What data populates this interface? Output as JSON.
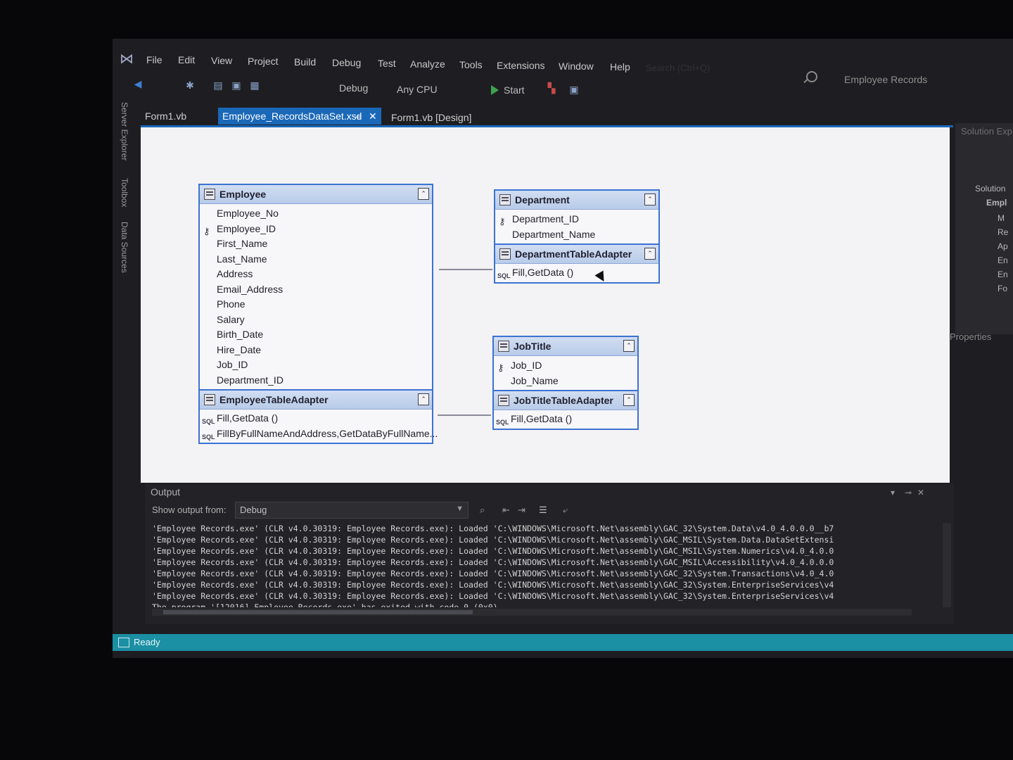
{
  "menu": {
    "items": [
      "File",
      "Edit",
      "View",
      "Project",
      "Build",
      "Debug",
      "Test",
      "Analyze",
      "Tools",
      "Extensions",
      "Window",
      "Help"
    ],
    "search_placeholder": "Search (Ctrl+Q)",
    "project_title": "Employee Records"
  },
  "toolbar": {
    "config": "Debug",
    "platform": "Any CPU",
    "start_label": "Start"
  },
  "side_tabs": [
    "Server Explorer",
    "Toolbox",
    "Data Sources"
  ],
  "tabs": [
    {
      "label": "Form1.vb",
      "active": false
    },
    {
      "label": "Employee_RecordsDataSet.xsd",
      "active": true
    },
    {
      "label": "Form1.vb [Design]",
      "active": false
    }
  ],
  "tables": {
    "employee": {
      "title": "Employee",
      "columns": [
        "Employee_No",
        "Employee_ID",
        "First_Name",
        "Last_Name",
        "Address",
        "Email_Address",
        "Phone",
        "Salary",
        "Birth_Date",
        "Hire_Date",
        "Job_ID",
        "Department_ID"
      ],
      "key_column": "Employee_ID",
      "adapter": "EmployeeTableAdapter",
      "queries": [
        "Fill,GetData ()",
        "FillByFullNameAndAddress,GetDataByFullName..."
      ]
    },
    "department": {
      "title": "Department",
      "columns": [
        "Department_ID",
        "Department_Name"
      ],
      "key_column": "Department_ID",
      "adapter": "DepartmentTableAdapter",
      "queries": [
        "Fill,GetData ()"
      ]
    },
    "jobtitle": {
      "title": "JobTitle",
      "columns": [
        "Job_ID",
        "Job_Name"
      ],
      "key_column": "Job_ID",
      "adapter": "JobTitleTableAdapter",
      "queries": [
        "Fill,GetData ()"
      ]
    }
  },
  "solution_explorer": {
    "title": "Solution Exp",
    "items": [
      "Solution",
      "Empl",
      "M",
      "Re",
      "Ap",
      "En",
      "En",
      "Fo"
    ]
  },
  "properties": {
    "title": "Properties"
  },
  "output": {
    "title": "Output",
    "show_from_label": "Show output from:",
    "source": "Debug",
    "lines": [
      "'Employee Records.exe' (CLR v4.0.30319: Employee Records.exe): Loaded 'C:\\WINDOWS\\Microsoft.Net\\assembly\\GAC_32\\System.Data\\v4.0_4.0.0.0__b7",
      "'Employee Records.exe' (CLR v4.0.30319: Employee Records.exe): Loaded 'C:\\WINDOWS\\Microsoft.Net\\assembly\\GAC_MSIL\\System.Data.DataSetExtensi",
      "'Employee Records.exe' (CLR v4.0.30319: Employee Records.exe): Loaded 'C:\\WINDOWS\\Microsoft.Net\\assembly\\GAC_MSIL\\System.Numerics\\v4.0_4.0.0",
      "'Employee Records.exe' (CLR v4.0.30319: Employee Records.exe): Loaded 'C:\\WINDOWS\\Microsoft.Net\\assembly\\GAC_MSIL\\Accessibility\\v4.0_4.0.0.0",
      "'Employee Records.exe' (CLR v4.0.30319: Employee Records.exe): Loaded 'C:\\WINDOWS\\Microsoft.Net\\assembly\\GAC_32\\System.Transactions\\v4.0_4.0",
      "'Employee Records.exe' (CLR v4.0.30319: Employee Records.exe): Loaded 'C:\\WINDOWS\\Microsoft.Net\\assembly\\GAC_32\\System.EnterpriseServices\\v4",
      "'Employee Records.exe' (CLR v4.0.30319: Employee Records.exe): Loaded 'C:\\WINDOWS\\Microsoft.Net\\assembly\\GAC_32\\System.EnterpriseServices\\v4",
      "The program '[12016] Employee Records.exe' has exited with code 0 (0x0)."
    ]
  },
  "status": {
    "text": "Ready"
  },
  "colors": {
    "accent": "#1a68b8",
    "status_bar": "#1b8fa3",
    "table_border": "#3c72d2"
  }
}
